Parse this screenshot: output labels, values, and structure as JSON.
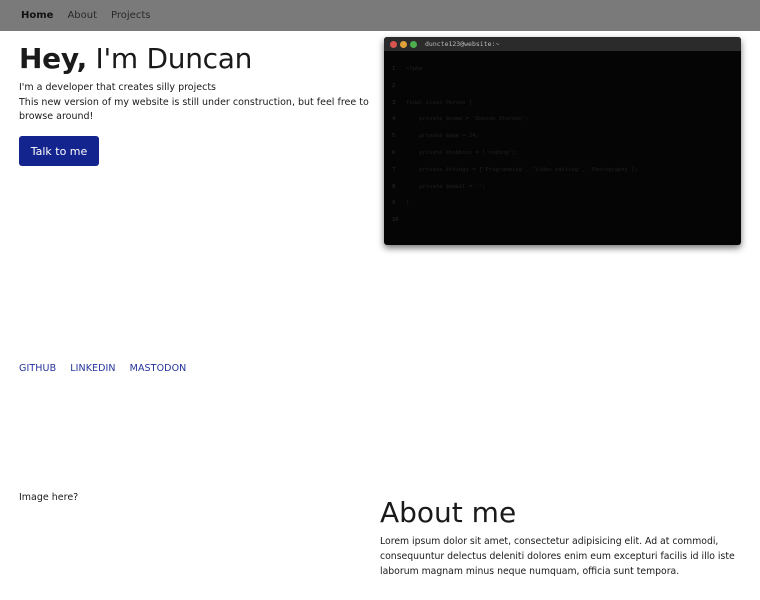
{
  "nav": {
    "items": [
      {
        "label": "Home",
        "active": true
      },
      {
        "label": "About",
        "active": false
      },
      {
        "label": "Projects",
        "active": false
      }
    ]
  },
  "hero": {
    "title_bold": "Hey,",
    "title_rest": " I'm Duncan",
    "line1": "I'm a developer that creates silly projects",
    "line2": "This new version of my website is still under construction, but feel free to browse around!",
    "cta_label": "Talk to me"
  },
  "terminal": {
    "title": "duncte123@website:~",
    "dot_colors": [
      "#d9534f",
      "#e0a13a",
      "#4cae4c"
    ],
    "lines": [
      "<?php",
      "",
      "final class Person {",
      "    private $name = 'Duncan Sterken';",
      "    private $age = 24;",
      "    private $hobbies = ['coding'];",
      "    private $things = ['Programming', 'Video editing', 'Photography'];",
      "    private $email = '';",
      "}",
      ""
    ]
  },
  "social": {
    "links": [
      "GITHUB",
      "LINKEDIN",
      "MASTODON"
    ]
  },
  "image_placeholder": "Image here?",
  "about": {
    "heading": "About me",
    "text": "Lorem ipsum dolor sit amet, consectetur adipisicing elit. Ad at commodi, consequuntur delectus deleniti dolores enim eum excepturi facilis id illo iste laborum magnam minus neque numquam, officia sunt tempora."
  },
  "colors": {
    "navbar_bg": "#7a7a7a",
    "accent": "#14248f",
    "link": "#24339b",
    "terminal_bg": "#050505"
  }
}
